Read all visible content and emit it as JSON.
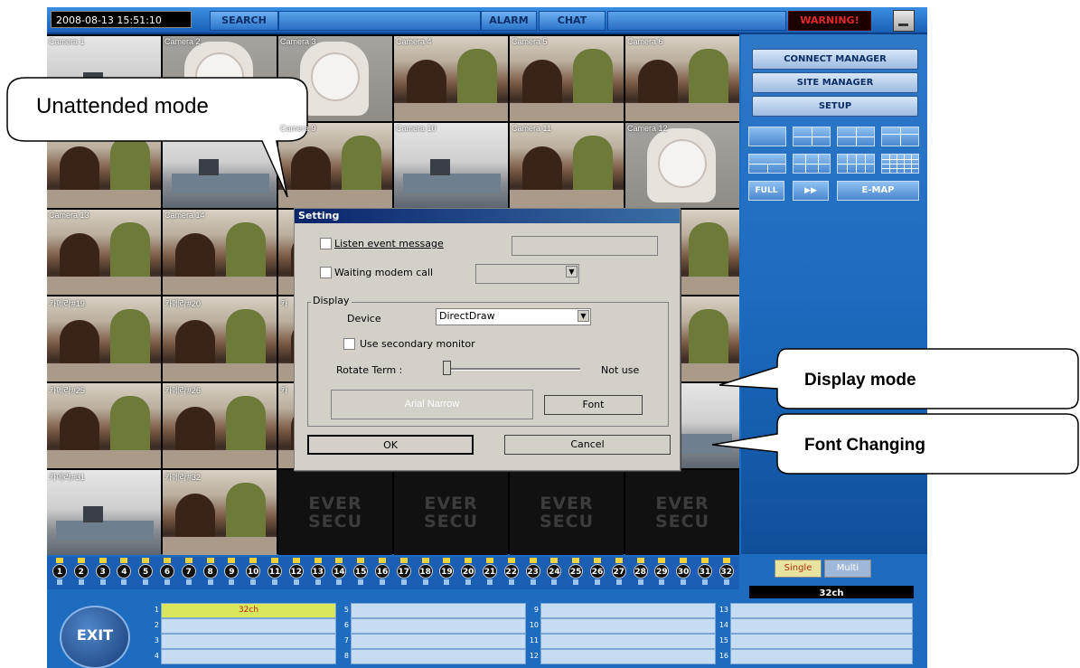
{
  "topbar": {
    "clock": "2008-08-13   15:51:10",
    "search_label": "SEARCH",
    "alarm_label": "ALARM",
    "chat_label": "CHAT",
    "warning_label": "WARNING!"
  },
  "cameras": {
    "row1": [
      "Camera 1",
      "Camera 2",
      "Camera 3",
      "Camera 4",
      "Camera 5",
      "Camera 6"
    ],
    "row2": [
      "",
      "",
      "Camera 9",
      "Camera 10",
      "Camera 11",
      "Camera 12"
    ],
    "row3": [
      "Camera 13",
      "Camera 14"
    ],
    "row4": [
      "카메라#19",
      "카메라#20",
      "카"
    ],
    "row5": [
      "카메라#25",
      "카메라#26",
      "카"
    ],
    "row6": [
      "카메라#31",
      "카메라#32"
    ],
    "logo": [
      "EVER",
      "SECU"
    ]
  },
  "right_panel": {
    "connect_manager": "CONNECT MANAGER",
    "site_manager": "SITE MANAGER",
    "setup": "SETUP",
    "full": "FULL",
    "emap": "E-MAP",
    "single": "Single",
    "multi": "Multi",
    "channel_count": "32ch"
  },
  "channels": [
    "1",
    "2",
    "3",
    "4",
    "5",
    "6",
    "7",
    "8",
    "9",
    "10",
    "11",
    "12",
    "13",
    "14",
    "15",
    "16",
    "17",
    "18",
    "19",
    "20",
    "21",
    "22",
    "23",
    "24",
    "25",
    "26",
    "27",
    "28",
    "29",
    "30",
    "31",
    "32"
  ],
  "bottom": {
    "exit_label": "EXIT",
    "slots": [
      {
        "n": "1",
        "v": "32ch"
      },
      {
        "n": "2",
        "v": ""
      },
      {
        "n": "3",
        "v": ""
      },
      {
        "n": "4",
        "v": ""
      },
      {
        "n": "5",
        "v": ""
      },
      {
        "n": "6",
        "v": ""
      },
      {
        "n": "7",
        "v": ""
      },
      {
        "n": "8",
        "v": ""
      },
      {
        "n": "9",
        "v": ""
      },
      {
        "n": "10",
        "v": ""
      },
      {
        "n": "11",
        "v": ""
      },
      {
        "n": "12",
        "v": ""
      },
      {
        "n": "13",
        "v": ""
      },
      {
        "n": "14",
        "v": ""
      },
      {
        "n": "15",
        "v": ""
      },
      {
        "n": "16",
        "v": ""
      }
    ]
  },
  "dialog": {
    "title": "Setting",
    "listen_event": "Listen event message",
    "waiting_modem": "Waiting modem call",
    "display_group": "Display",
    "device_label": "Device",
    "device_value": "DirectDraw",
    "secondary_monitor": "Use secondary monitor",
    "rotate_term": "Rotate Term :",
    "rotate_value": "Not use",
    "font_preview": "Arial Narrow",
    "font_button": "Font",
    "ok": "OK",
    "cancel": "Cancel"
  },
  "callouts": {
    "unattended": "Unattended mode",
    "display_mode": "Display mode",
    "font_changing": "Font Changing"
  },
  "colors": {
    "app_blue": "#1d6cc0",
    "warning_red": "#e02a2a",
    "active_slot": "#d9e85a",
    "dialog_grey": "#d4d0c8"
  }
}
